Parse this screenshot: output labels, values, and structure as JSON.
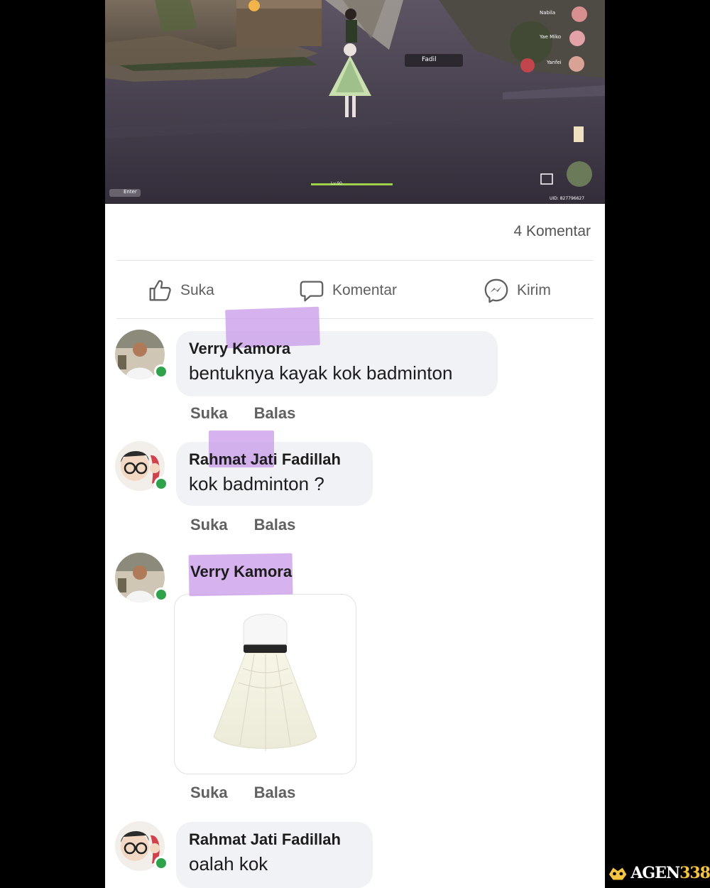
{
  "game": {
    "player_label": "Fadil",
    "party": [
      "Nabila",
      "Yae Miko",
      "Yanfei"
    ],
    "uid": "UID: 827796627",
    "enter_label": "Enter",
    "health_label": "Lv.90"
  },
  "post": {
    "comment_count": "4 Komentar",
    "actions": {
      "like": "Suka",
      "comment": "Komentar",
      "send": "Kirim"
    }
  },
  "comments": [
    {
      "name": "Verry Kamora",
      "text": "bentuknya kayak kok badminton",
      "like": "Suka",
      "reply": "Balas"
    },
    {
      "name": "Rahmat Jati Fadillah",
      "text": "kok badminton ?",
      "like": "Suka",
      "reply": "Balas"
    },
    {
      "name": "Verry Kamora",
      "image": "shuttlecock-image",
      "like": "Suka",
      "reply": "Balas"
    },
    {
      "name": "Rahmat Jati Fadillah",
      "text": "oalah kok"
    }
  ],
  "watermark": {
    "brand": "AGEN",
    "number": "338"
  },
  "colors": {
    "online": "#31a24c",
    "highlight": "#c89ae8",
    "bubble": "#f0f2f5"
  }
}
